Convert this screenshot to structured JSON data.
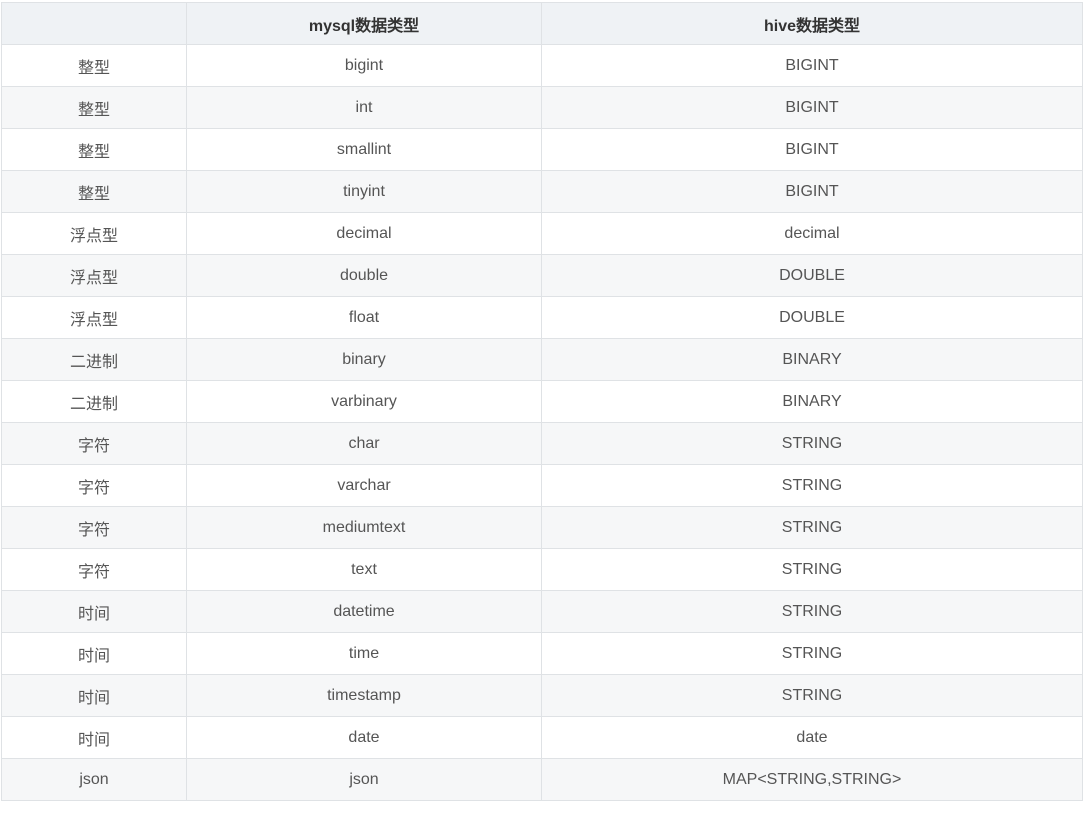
{
  "table": {
    "headers": [
      "",
      "mysql数据类型",
      "hive数据类型"
    ],
    "rows": [
      [
        "整型",
        "bigint",
        "BIGINT"
      ],
      [
        "整型",
        "int",
        "BIGINT"
      ],
      [
        "整型",
        "smallint",
        "BIGINT"
      ],
      [
        "整型",
        "tinyint",
        "BIGINT"
      ],
      [
        "浮点型",
        "decimal",
        "decimal"
      ],
      [
        "浮点型",
        "double",
        "DOUBLE"
      ],
      [
        "浮点型",
        "float",
        "DOUBLE"
      ],
      [
        "二进制",
        "binary",
        "BINARY"
      ],
      [
        "二进制",
        "varbinary",
        "BINARY"
      ],
      [
        "字符",
        "char",
        "STRING"
      ],
      [
        "字符",
        "varchar",
        "STRING"
      ],
      [
        "字符",
        "mediumtext",
        "STRING"
      ],
      [
        "字符",
        "text",
        "STRING"
      ],
      [
        "时间",
        "datetime",
        "STRING"
      ],
      [
        "时间",
        "time",
        "STRING"
      ],
      [
        "时间",
        "timestamp",
        "STRING"
      ],
      [
        "时间",
        "date",
        "date"
      ],
      [
        "json",
        "json",
        "MAP<STRING,STRING>"
      ]
    ]
  }
}
